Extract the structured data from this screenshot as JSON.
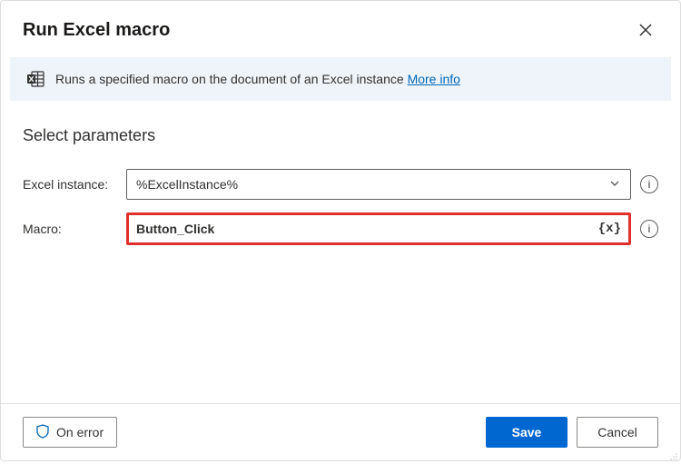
{
  "header": {
    "title": "Run Excel macro"
  },
  "banner": {
    "text": "Runs a specified macro on the document of an Excel instance",
    "link_label": "More info"
  },
  "section": {
    "title": "Select parameters"
  },
  "fields": {
    "excel_instance": {
      "label": "Excel instance:",
      "value": "%ExcelInstance%"
    },
    "macro": {
      "label": "Macro:",
      "value": "Button_Click",
      "var_token": "{x}"
    }
  },
  "footer": {
    "on_error_label": "On error",
    "save_label": "Save",
    "cancel_label": "Cancel"
  }
}
